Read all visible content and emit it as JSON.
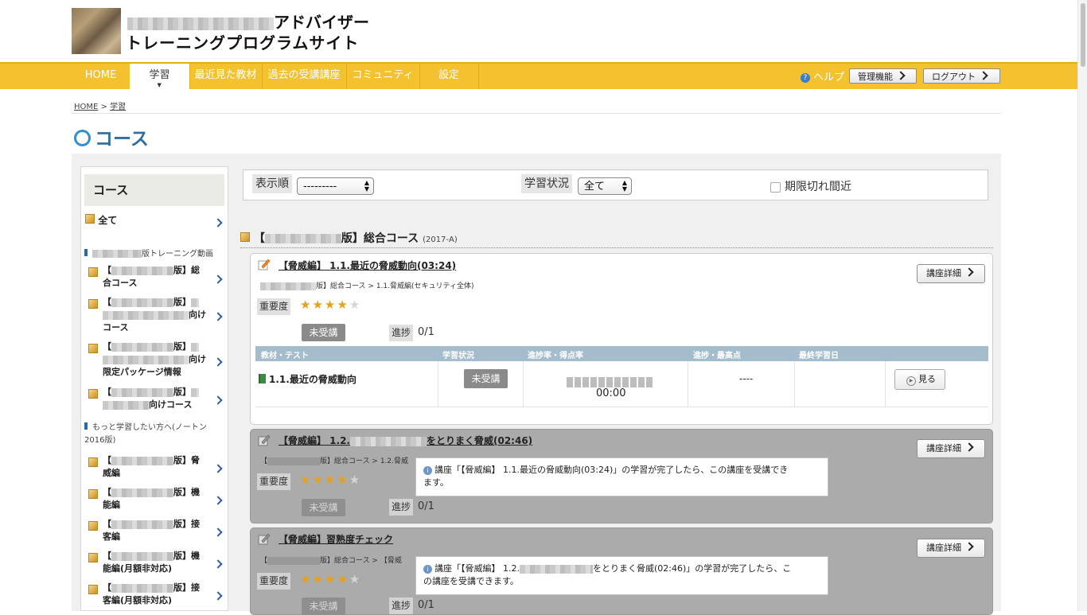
{
  "site": {
    "title_line1_suffix": "アドバイザー",
    "title_line2": "トレーニングプログラムサイト"
  },
  "nav": {
    "items": [
      "HOME",
      "学習",
      "最近見た教材",
      "過去の受講講座",
      "コミュニティ",
      "設定"
    ],
    "active": "学習",
    "help": "ヘルプ",
    "admin_button": "管理機能",
    "logout_button": "ログアウト"
  },
  "breadcrumb": {
    "home": "HOME",
    "sep": ">",
    "current": "学習"
  },
  "page_title": "コース",
  "sidebar": {
    "heading": "コース",
    "all": "全て",
    "section1": "版トレーニング動画",
    "items1": [
      {
        "l1a": "【",
        "l1b": "版】総",
        "l2": "合コース"
      },
      {
        "l1a": "【",
        "l1b": "版】",
        "l2b": "向け",
        "l3": "コース"
      },
      {
        "l1a": "【",
        "l1b": "版】",
        "l2b": "向け",
        "l3": "限定パッケージ情報"
      },
      {
        "l1a": "【",
        "l1b": "版】",
        "l2b": "向けコース"
      }
    ],
    "section2a": "もっと学習したい方へ(ノートン",
    "section2b": "2016版)",
    "items2": [
      {
        "l1a": "【",
        "l1b": "版】脅",
        "l2": "威編"
      },
      {
        "l1a": "【",
        "l1b": "版】機",
        "l2": "能編"
      },
      {
        "l1a": "【",
        "l1b": "版】接",
        "l2": "客編"
      },
      {
        "l1a": "【",
        "l1b": "版】機",
        "l2": "能編(月額非対応)"
      },
      {
        "l1a": "【",
        "l1b": "版】接",
        "l2": "客編(月額非対応)"
      }
    ]
  },
  "filter": {
    "order_label": "表示順",
    "order_value": "---------",
    "status_label": "学習状況",
    "status_value": "全て",
    "expiry_label": "期限切れ間近"
  },
  "course": {
    "title_prefix": "【",
    "title_suffix": "版】総合コース",
    "year": "(2017-A)"
  },
  "lessons": [
    {
      "title": "【脅威編】 1.1.最近の脅威動向(03:24)",
      "path": "版】総合コース > 1.1.脅威編(セキュリティ全体)",
      "importance_label": "重要度",
      "stars": 4,
      "status": "未受講",
      "progress_label": "進捗",
      "progress": "0/1",
      "detail_button": "講座詳細",
      "table": {
        "headers": [
          "教材・テスト",
          "学習状況",
          "進捗率・得点率",
          "進捗・最高点",
          "最終学習日"
        ],
        "row": {
          "name": "1.1.最近の脅威動向",
          "status": "未受講",
          "time": "00:00",
          "high": "----",
          "last": "",
          "view": "見る"
        }
      }
    },
    {
      "title_a": "【脅威編】 1.2.",
      "title_b": "をとりまく脅威(02:46)",
      "path_a": "【",
      "path_b": "版】総合コース > 1.2.脅威",
      "importance_label": "重要度",
      "stars": 4,
      "status": "未受講",
      "progress_label": "進捗",
      "progress": "0/1",
      "detail_button": "講座詳細",
      "tooltip": "講座「【脅威編】 1.1.最近の脅威動向(03:24)」の学習が完了したら、この講座を受講でき",
      "tooltip2": "ます。"
    },
    {
      "title": "【脅威編】習熟度チェック",
      "path_a": "【",
      "path_b": "版】総合コース > 【脅威",
      "importance_label": "重要度",
      "stars": 4,
      "status": "未受講",
      "progress_label": "進捗",
      "progress": "0/1",
      "detail_button": "講座詳細",
      "tooltip_a": "講座「【脅威編】 1.2.",
      "tooltip_b": "をとりまく脅威(02:46)」の学習が完了したら、こ",
      "tooltip2": "の講座を受講できます。"
    }
  ],
  "colors": {
    "nav": "#f3c22e",
    "accent": "#2f6e9e",
    "table_header": "#a4bccc",
    "star": "#e6a01c"
  }
}
